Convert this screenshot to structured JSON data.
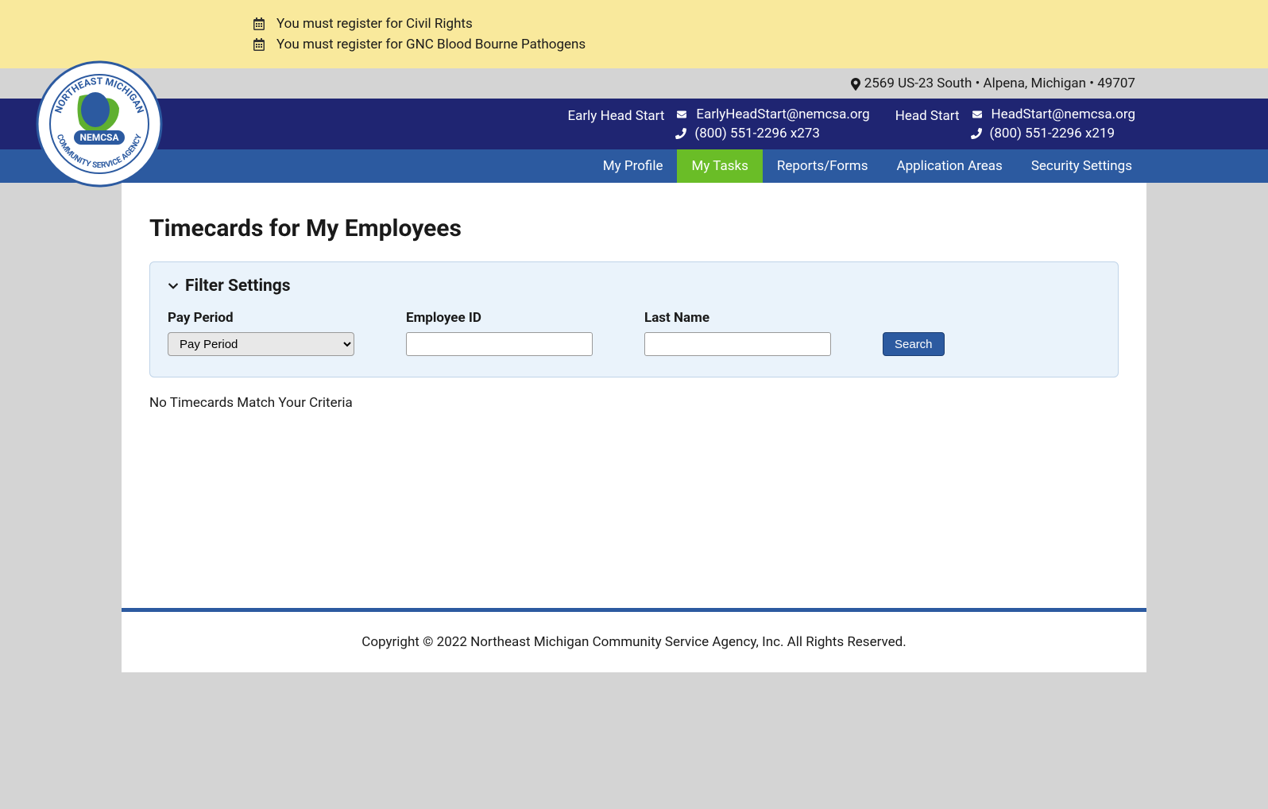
{
  "alerts": [
    "You must register for Civil Rights",
    "You must register for GNC Blood Bourne Pathogens"
  ],
  "address": "2569 US-23 South • Alpena, Michigan • 49707",
  "contacts": [
    {
      "label": "Early Head Start",
      "email": "EarlyHeadStart@nemcsa.org",
      "phone": "(800) 551-2296 x273"
    },
    {
      "label": "Head Start",
      "email": "HeadStart@nemcsa.org",
      "phone": "(800) 551-2296 x219"
    }
  ],
  "nav": {
    "items": [
      {
        "label": "My Profile",
        "active": false
      },
      {
        "label": "My Tasks",
        "active": true
      },
      {
        "label": "Reports/Forms",
        "active": false
      },
      {
        "label": "Application Areas",
        "active": false
      },
      {
        "label": "Security Settings",
        "active": false
      }
    ]
  },
  "logo": {
    "top_text": "NORTHEAST MICHIGAN",
    "band_text": "NEMCSA",
    "bottom_text": "COMMUNITY SERVICE AGENCY"
  },
  "page": {
    "title": "Timecards for My Employees"
  },
  "filter": {
    "header": "Filter Settings",
    "pay_period_label": "Pay Period",
    "pay_period_value": "Pay Period",
    "employee_id_label": "Employee ID",
    "employee_id_value": "",
    "last_name_label": "Last Name",
    "last_name_value": "",
    "search_label": "Search"
  },
  "results": {
    "empty_message": "No Timecards Match Your Criteria"
  },
  "footer": {
    "copyright": "Copyright © 2022 Northeast Michigan Community Service Agency, Inc. All Rights Reserved."
  }
}
